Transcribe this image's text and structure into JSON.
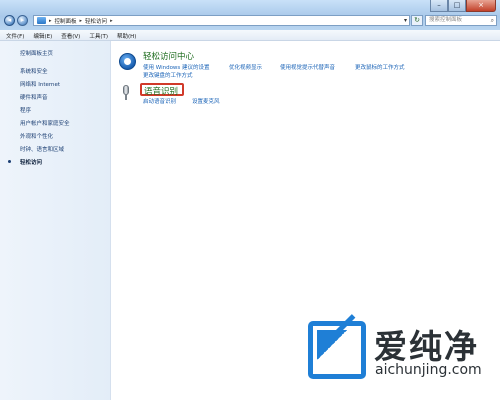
{
  "window": {
    "address_segments": [
      "控制面板",
      "轻松访问"
    ],
    "search_placeholder": "搜索控制面板",
    "minimize": "–",
    "maximize": "□",
    "close": "×"
  },
  "menu": [
    "文件(F)",
    "编辑(E)",
    "查看(V)",
    "工具(T)",
    "帮助(H)"
  ],
  "sidebar": {
    "home": "控制面板主页",
    "items": [
      "系统和安全",
      "网络和 Internet",
      "硬件和声音",
      "程序",
      "用户帐户和家庭安全",
      "外观和个性化",
      "时钟、语言和区域",
      "轻松访问"
    ],
    "current_index": 7
  },
  "categories": [
    {
      "title": "轻松访问中心",
      "links": [
        "使用 Windows 建议的设置",
        "优化视频显示",
        "使用视觉提示代替声音",
        "更改鼠标的工作方式",
        "更改键盘的工作方式"
      ],
      "icon": "ease-of-access-icon"
    },
    {
      "title": "语音识别",
      "links": [
        "启动语音识别",
        "设置麦克风"
      ],
      "icon": "microphone-icon",
      "highlighted": true
    }
  ],
  "watermark": {
    "chinese": "爱纯净",
    "english": "aichunjing.com"
  },
  "colors": {
    "link": "#1a63b7",
    "category_title": "#1c6b1c",
    "highlight": "#d13a2a",
    "watermark_blue": "#1f7fd6"
  }
}
